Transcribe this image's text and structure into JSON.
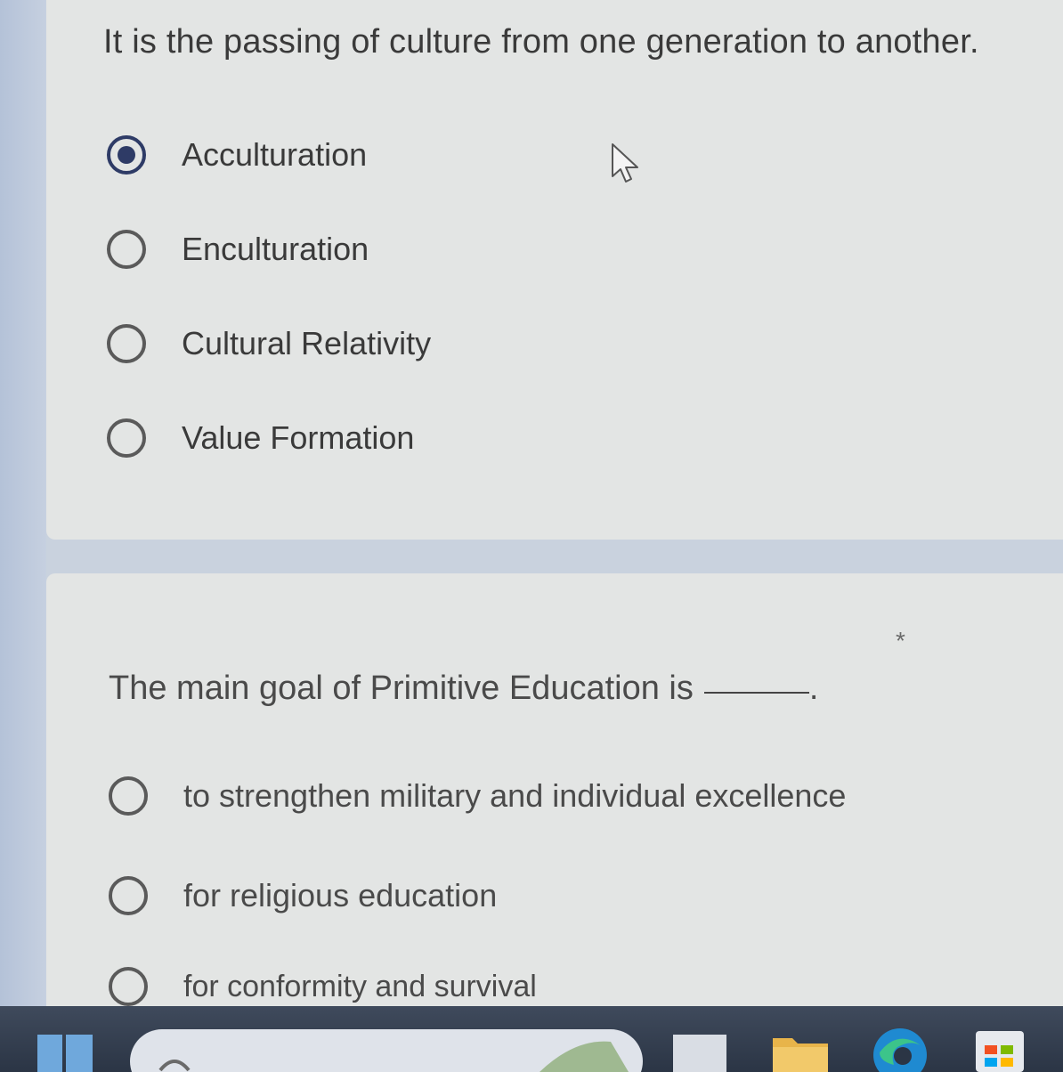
{
  "question1": {
    "text": "It is the passing of culture from one generation to another.",
    "options": [
      {
        "label": "Acculturation",
        "selected": true
      },
      {
        "label": "Enculturation",
        "selected": false
      },
      {
        "label": "Cultural Relativity",
        "selected": false
      },
      {
        "label": "Value Formation",
        "selected": false
      }
    ]
  },
  "question2": {
    "text": "The main goal of Primitive Education is",
    "blank_suffix": ".",
    "required_marker": "*",
    "options": [
      {
        "label": "to strengthen military and individual excellence",
        "selected": false
      },
      {
        "label": "for religious education",
        "selected": false
      },
      {
        "label": "for conformity and survival",
        "selected": false
      }
    ]
  },
  "colors": {
    "selected_radio": "#2e3b66",
    "card_background": "#e3e5e4",
    "page_background": "#c9d2de",
    "taskbar": "#2b3545"
  },
  "icons": [
    "mouse-cursor-icon",
    "start-icon",
    "search-icon",
    "file-explorer-icon",
    "edge-browser-icon",
    "store-icon"
  ]
}
